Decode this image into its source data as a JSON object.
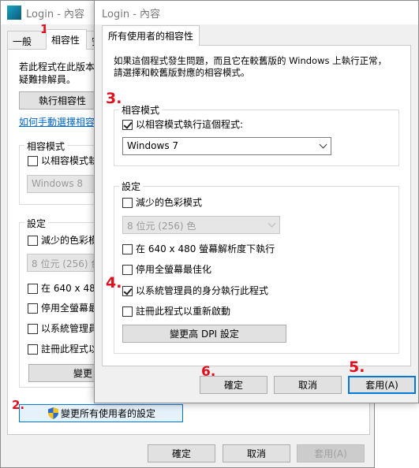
{
  "back_window": {
    "title": "Login - 內容",
    "tabs": [
      "一般",
      "相容性",
      "安"
    ],
    "desc_line1": "若此程式在此版本",
    "desc_line2": "疑難排解員。",
    "troubleshoot_button": "執行相容性",
    "manual_link": "如何手動選擇相容性",
    "compat_group_title": "相容模式",
    "compat_checkbox_label": "以相容模式執",
    "compat_select_value": "Windows 8",
    "settings_group_title": "設定",
    "settings": [
      {
        "label": "減少的色彩模",
        "checked": false
      },
      {
        "label": "在 640 x 480",
        "checked": false
      },
      {
        "label": "停用全螢幕最",
        "checked": false
      },
      {
        "label": "以系統管理員",
        "checked": false
      },
      {
        "label": "註冊此程式以",
        "checked": false
      }
    ],
    "color_select_value": "8 位元 (256) 色",
    "change_dpi_button": "變更",
    "all_users_button": "變更所有使用者的設定",
    "ok_button": "確定",
    "cancel_button": "取消",
    "apply_button": "套用(A)"
  },
  "front_window": {
    "title": "Login - 內容",
    "tab": "所有使用者的相容性",
    "desc_line1": "如果這個程式發生問題，而且它在較舊版的 Windows 上執行正常，",
    "desc_line2": "請選擇和較舊版對應的相容模式。",
    "compat_group_title": "相容模式",
    "compat_checkbox_label": "以相容模式執行這個程式:",
    "compat_checked": true,
    "compat_select_value": "Windows 7",
    "settings_group_title": "設定",
    "reduced_color_label": "減少的色彩模式",
    "color_select_value": "8 位元 (256) 色",
    "res_label": "在 640 x 480 螢幕解析度下執行",
    "fullscreen_label": "停用全螢幕最佳化",
    "admin_label": "以系統管理員的身分執行此程式",
    "admin_checked": true,
    "register_label": "註冊此程式以重新啟動",
    "change_dpi_button": "變更高 DPI 設定",
    "ok_button": "確定",
    "cancel_button": "取消",
    "apply_button": "套用(A)"
  },
  "annotations": {
    "step1": "1.",
    "step2": "2.",
    "step3": "3.",
    "step4": "4.",
    "step5": "5.",
    "step6": "6."
  },
  "colors": {
    "accent": "#0078d7",
    "annotation_red": "#e0101e",
    "link": "#0066cc"
  }
}
